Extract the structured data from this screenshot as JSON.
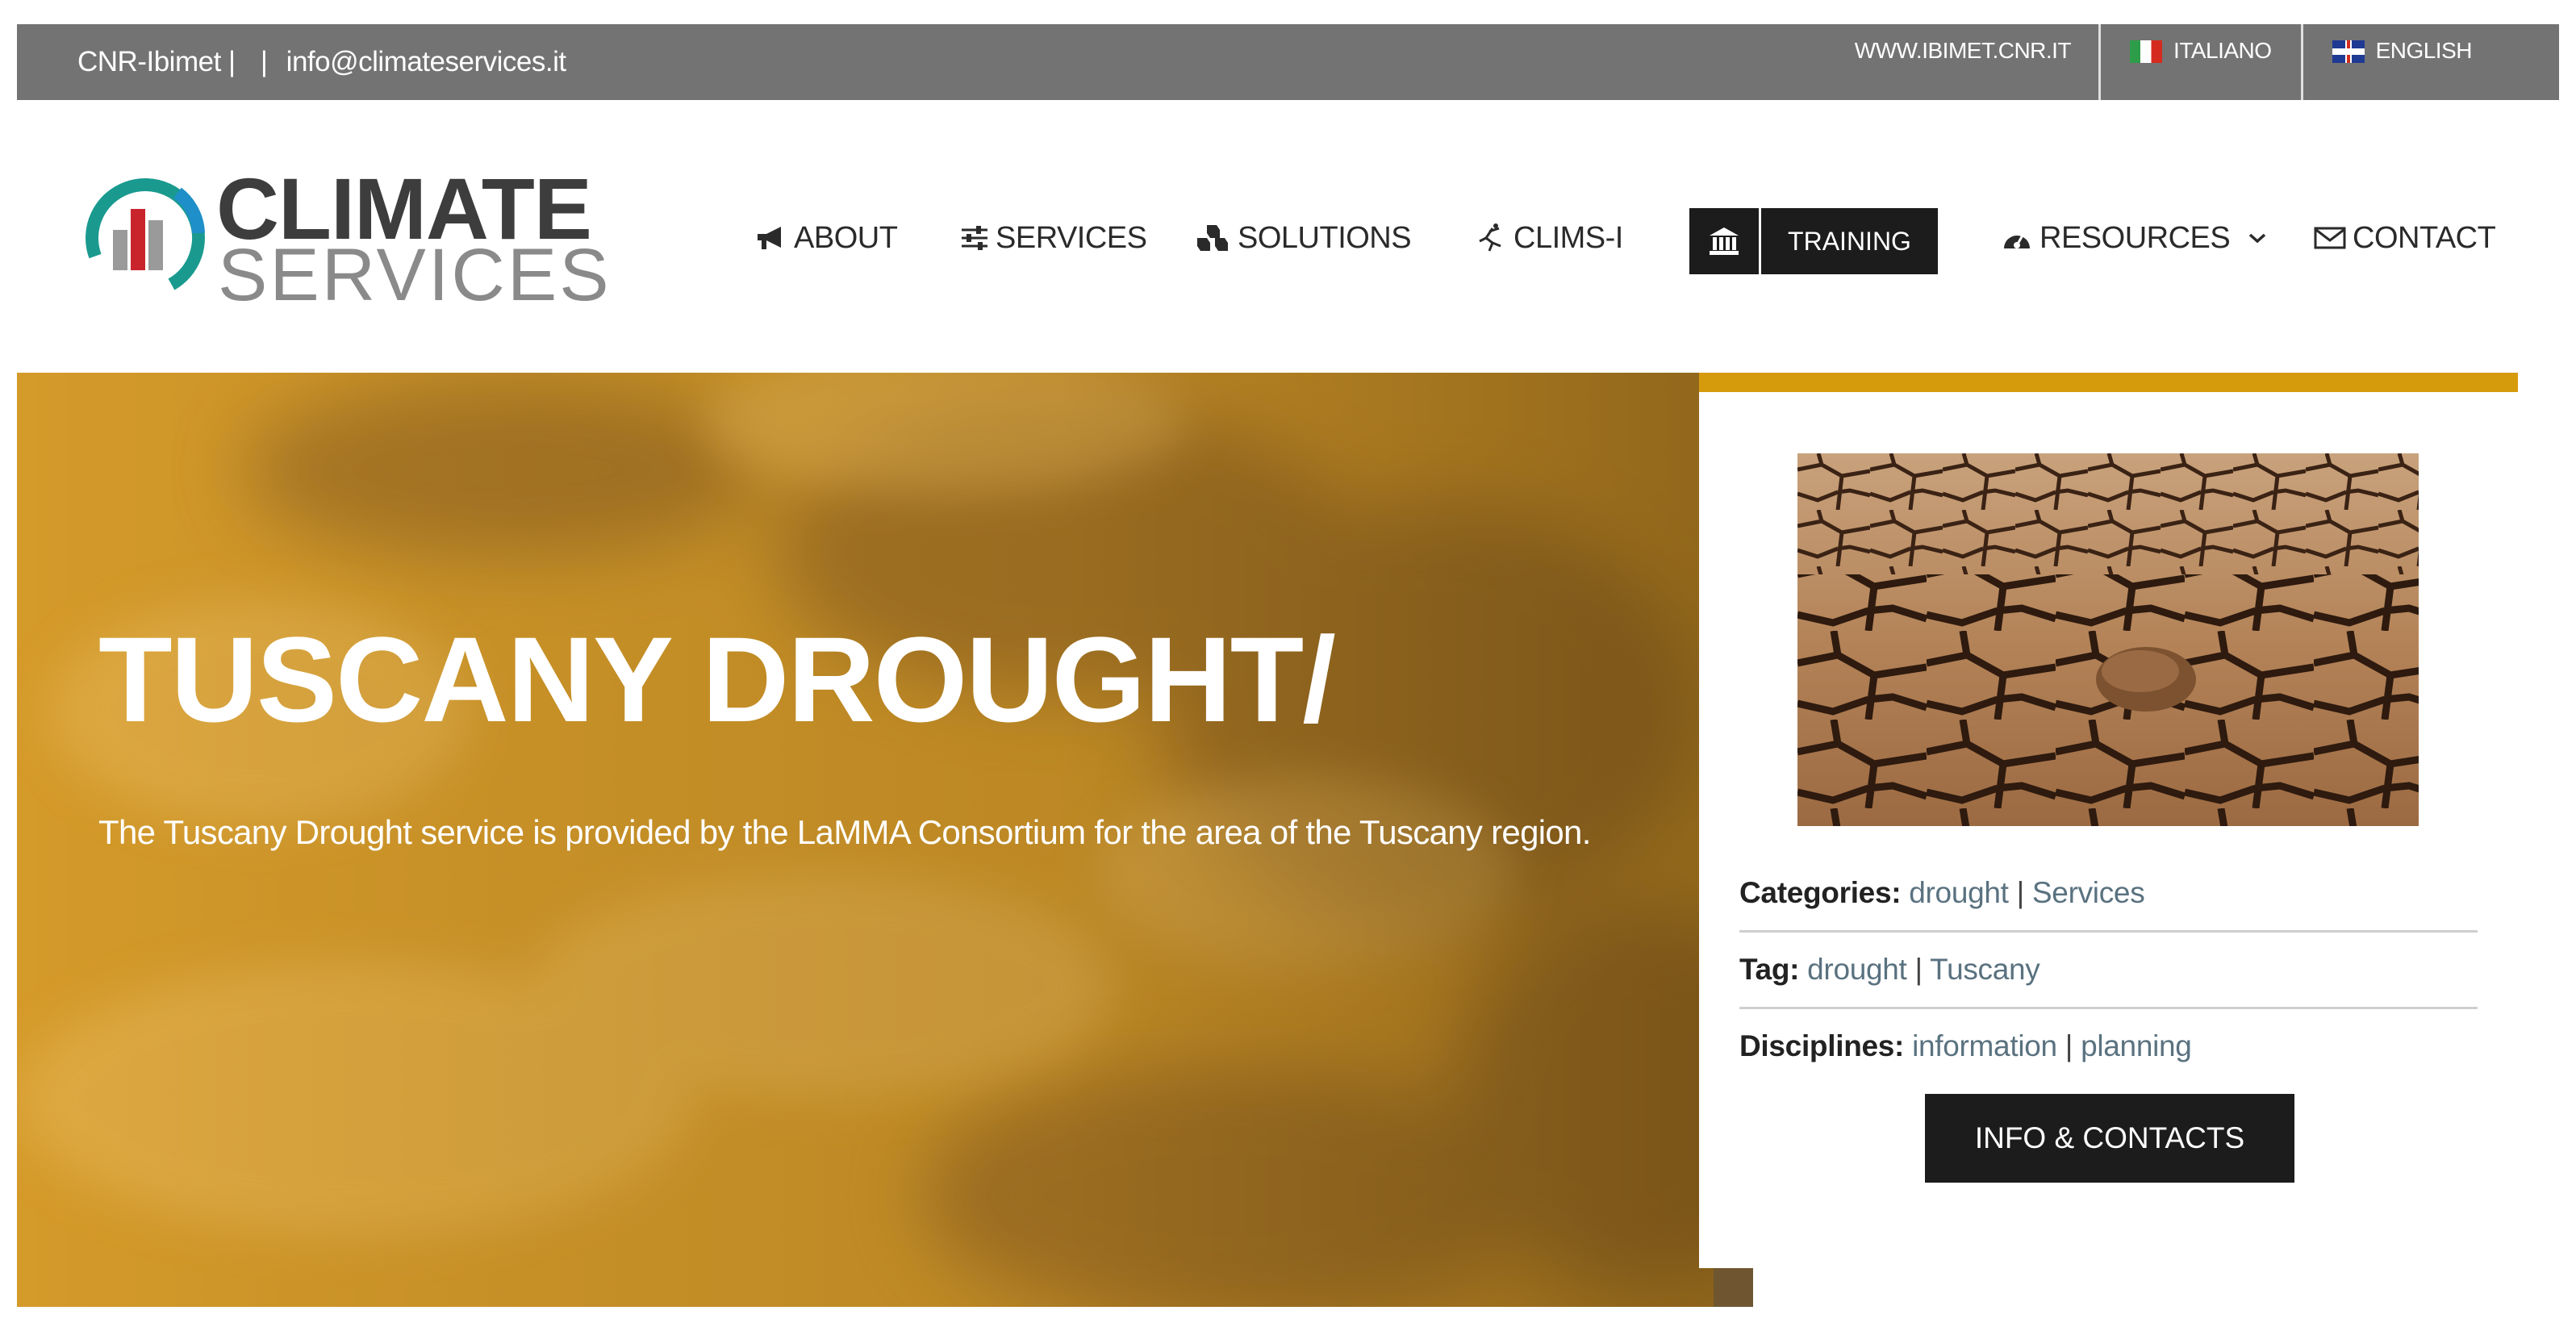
{
  "topbar": {
    "org": "CNR-Ibimet |",
    "separator": "|",
    "email": "info@climateservices.it",
    "site": "WWW.IBIMET.CNR.IT",
    "languages": [
      {
        "label": "ITALIANO",
        "flag": "flag-italy-icon"
      },
      {
        "label": "ENGLISH",
        "flag": "flag-uk-icon"
      }
    ]
  },
  "logo": {
    "word1": "CLIMATE",
    "word2": "SERVICES"
  },
  "nav": {
    "about": "ABOUT",
    "services": "SERVICES",
    "solutions": "SOLUTIONS",
    "clims": "CLIMS-I",
    "training": "TRAINING",
    "resources": "RESOURCES",
    "contact": "CONTACT"
  },
  "hero": {
    "title": "TUSCANY DROUGHT/",
    "description": "The Tuscany Drought service is provided by the LaMMA Consortium for the area of the Tuscany region."
  },
  "card": {
    "categories_label": "Categories:",
    "categories": [
      "drought",
      "Services"
    ],
    "tag_label": "Tag:",
    "tags": [
      "drought",
      "Tuscany"
    ],
    "disciplines_label": "Disciplines:",
    "disciplines": [
      "information",
      "planning"
    ],
    "list_separator": "|",
    "button": "INFO & CONTACTS"
  },
  "colors": {
    "topbar": "#737373",
    "hero": "#d49a2a",
    "accent": "#d69a0d",
    "dark": "#1c1c1c",
    "link": "#5a7280"
  }
}
